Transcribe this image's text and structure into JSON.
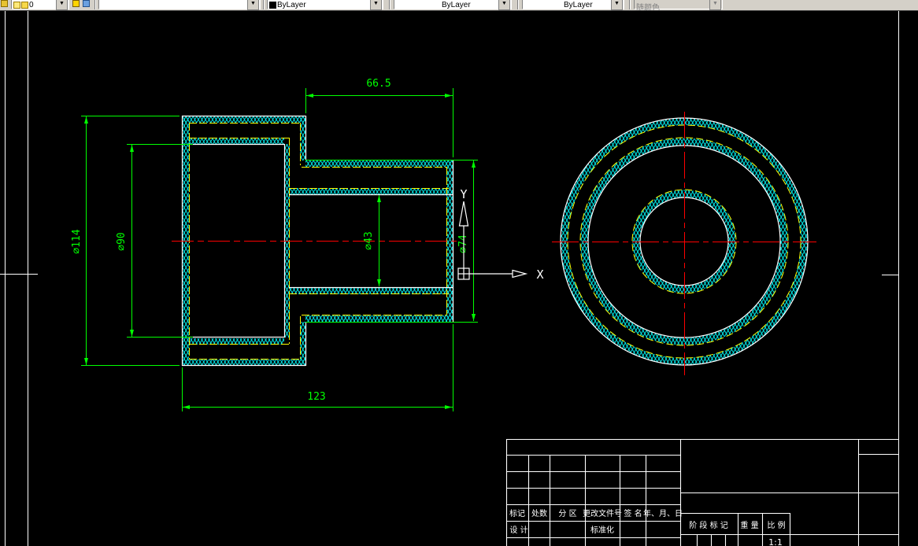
{
  "app": {
    "background_color": "#000000",
    "toolbar_background": "#d4d0c8"
  },
  "toolbar": {
    "layer_combo": {
      "value": "0"
    },
    "layer_state_combo": {
      "value": ""
    },
    "color_combo": {
      "value": "ByLayer"
    },
    "linetype_combo": {
      "value": "ByLayer"
    },
    "lineweight_combo": {
      "value": "ByLayer"
    },
    "plotstyle_combo": {
      "value": "随颜色",
      "disabled": true
    },
    "dropdown_arrow": "▼"
  },
  "drawing": {
    "colors": {
      "outline": "#ffffff",
      "hatch": "#00e8e8",
      "soft_line": "#ffff00",
      "dimension": "#00ff00",
      "centerline": "#ff0000"
    },
    "dimensions": {
      "top_length": "66.5",
      "total_length": "123",
      "outer_diameter": "∅114",
      "large_bore_diameter": "∅90",
      "small_bore_diameter": "∅43",
      "small_outer_diameter": "∅74"
    },
    "ucs": {
      "x_label": "X",
      "y_label": "Y"
    }
  },
  "title_block": {
    "header_row": [
      "标记",
      "处数",
      "分 区",
      "更改文件号",
      "签 名",
      "年、月、日"
    ],
    "design_label": "设 计",
    "standard_label": "标准化",
    "stage_label": "阶 段 标 记",
    "weight_label": "重 量",
    "scale_label": "比 例",
    "scale_value": "1:1"
  }
}
